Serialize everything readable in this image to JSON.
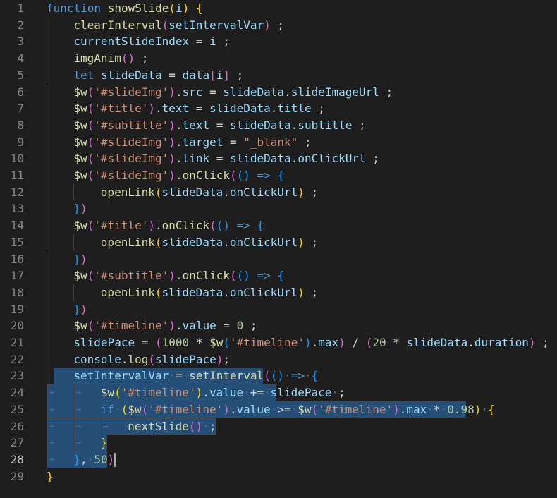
{
  "editor": {
    "active_line": 28,
    "colors": {
      "background": "#1e1e1e",
      "selection": "#264f78",
      "keyword": "#569cd6",
      "function": "#dcdcaa",
      "variable": "#9cdcfe",
      "string": "#ce9178",
      "number": "#b5cea8"
    },
    "lines": [
      {
        "n": 1,
        "indent": 0,
        "tokens": [
          [
            "kw",
            "function"
          ],
          [
            "p",
            " "
          ],
          [
            "fn",
            "showSlide"
          ],
          [
            "b1",
            "("
          ],
          [
            "var",
            "i"
          ],
          [
            "b1",
            ")"
          ],
          [
            "p",
            " "
          ],
          [
            "b1",
            "{"
          ]
        ]
      },
      {
        "n": 2,
        "indent": 1,
        "tokens": [
          [
            "fn",
            "clearInterval"
          ],
          [
            "b2",
            "("
          ],
          [
            "var",
            "setIntervalVar"
          ],
          [
            "b2",
            ")"
          ],
          [
            "p",
            " ;"
          ]
        ]
      },
      {
        "n": 3,
        "indent": 1,
        "tokens": [
          [
            "var",
            "currentSlideIndex"
          ],
          [
            "p",
            " = "
          ],
          [
            "var",
            "i"
          ],
          [
            "p",
            " ;"
          ]
        ]
      },
      {
        "n": 4,
        "indent": 1,
        "tokens": [
          [
            "fn",
            "imgAnim"
          ],
          [
            "b2",
            "()"
          ],
          [
            "p",
            " ;"
          ]
        ]
      },
      {
        "n": 5,
        "indent": 1,
        "tokens": [
          [
            "kw",
            "let"
          ],
          [
            "p",
            " "
          ],
          [
            "var",
            "slideData"
          ],
          [
            "p",
            " = "
          ],
          [
            "var",
            "data"
          ],
          [
            "b2",
            "["
          ],
          [
            "var",
            "i"
          ],
          [
            "b2",
            "]"
          ],
          [
            "p",
            " ;"
          ]
        ]
      },
      {
        "n": 6,
        "indent": 1,
        "tokens": [
          [
            "fn",
            "$w"
          ],
          [
            "b2",
            "("
          ],
          [
            "str",
            "'#slideImg'"
          ],
          [
            "b2",
            ")"
          ],
          [
            "p",
            "."
          ],
          [
            "var",
            "src"
          ],
          [
            "p",
            " = "
          ],
          [
            "var",
            "slideData"
          ],
          [
            "p",
            "."
          ],
          [
            "var",
            "slideImageUrl"
          ],
          [
            "p",
            " ;"
          ]
        ]
      },
      {
        "n": 7,
        "indent": 1,
        "tokens": [
          [
            "fn",
            "$w"
          ],
          [
            "b2",
            "("
          ],
          [
            "str",
            "'#title'"
          ],
          [
            "b2",
            ")"
          ],
          [
            "p",
            "."
          ],
          [
            "var",
            "text"
          ],
          [
            "p",
            " = "
          ],
          [
            "var",
            "slideData"
          ],
          [
            "p",
            "."
          ],
          [
            "var",
            "title"
          ],
          [
            "p",
            " ;"
          ]
        ]
      },
      {
        "n": 8,
        "indent": 1,
        "tokens": [
          [
            "fn",
            "$w"
          ],
          [
            "b2",
            "("
          ],
          [
            "str",
            "'#subtitle'"
          ],
          [
            "b2",
            ")"
          ],
          [
            "p",
            "."
          ],
          [
            "var",
            "text"
          ],
          [
            "p",
            " = "
          ],
          [
            "var",
            "slideData"
          ],
          [
            "p",
            "."
          ],
          [
            "var",
            "subtitle"
          ],
          [
            "p",
            " ;"
          ]
        ]
      },
      {
        "n": 9,
        "indent": 1,
        "tokens": [
          [
            "fn",
            "$w"
          ],
          [
            "b2",
            "("
          ],
          [
            "str",
            "'#slideImg'"
          ],
          [
            "b2",
            ")"
          ],
          [
            "p",
            "."
          ],
          [
            "var",
            "target"
          ],
          [
            "p",
            " = "
          ],
          [
            "str",
            "\"_blank\""
          ],
          [
            "p",
            " ;"
          ]
        ]
      },
      {
        "n": 10,
        "indent": 1,
        "tokens": [
          [
            "fn",
            "$w"
          ],
          [
            "b2",
            "("
          ],
          [
            "str",
            "'#slideImg'"
          ],
          [
            "b2",
            ")"
          ],
          [
            "p",
            "."
          ],
          [
            "var",
            "link"
          ],
          [
            "p",
            " = "
          ],
          [
            "var",
            "slideData"
          ],
          [
            "p",
            "."
          ],
          [
            "var",
            "onClickUrl"
          ],
          [
            "p",
            " ;"
          ]
        ]
      },
      {
        "n": 11,
        "indent": 1,
        "tokens": [
          [
            "fn",
            "$w"
          ],
          [
            "b2",
            "("
          ],
          [
            "str",
            "'#slideImg'"
          ],
          [
            "b2",
            ")"
          ],
          [
            "p",
            "."
          ],
          [
            "fn",
            "onClick"
          ],
          [
            "b2",
            "("
          ],
          [
            "b3",
            "()"
          ],
          [
            "p",
            " "
          ],
          [
            "kw",
            "=>"
          ],
          [
            "p",
            " "
          ],
          [
            "b3",
            "{"
          ]
        ]
      },
      {
        "n": 12,
        "indent": 2,
        "tokens": [
          [
            "fn",
            "openLink"
          ],
          [
            "b1",
            "("
          ],
          [
            "var",
            "slideData"
          ],
          [
            "p",
            "."
          ],
          [
            "var",
            "onClickUrl"
          ],
          [
            "b1",
            ")"
          ],
          [
            "p",
            " ;"
          ]
        ]
      },
      {
        "n": 13,
        "indent": 1,
        "tokens": [
          [
            "b3",
            "}"
          ],
          [
            "b2",
            ")"
          ]
        ]
      },
      {
        "n": 14,
        "indent": 1,
        "tokens": [
          [
            "fn",
            "$w"
          ],
          [
            "b2",
            "("
          ],
          [
            "str",
            "'#title'"
          ],
          [
            "b2",
            ")"
          ],
          [
            "p",
            "."
          ],
          [
            "fn",
            "onClick"
          ],
          [
            "b2",
            "("
          ],
          [
            "b3",
            "()"
          ],
          [
            "p",
            " "
          ],
          [
            "kw",
            "=>"
          ],
          [
            "p",
            " "
          ],
          [
            "b3",
            "{"
          ]
        ]
      },
      {
        "n": 15,
        "indent": 2,
        "tokens": [
          [
            "fn",
            "openLink"
          ],
          [
            "b1",
            "("
          ],
          [
            "var",
            "slideData"
          ],
          [
            "p",
            "."
          ],
          [
            "var",
            "onClickUrl"
          ],
          [
            "b1",
            ")"
          ],
          [
            "p",
            " ;"
          ]
        ]
      },
      {
        "n": 16,
        "indent": 1,
        "tokens": [
          [
            "b3",
            "}"
          ],
          [
            "b2",
            ")"
          ]
        ]
      },
      {
        "n": 17,
        "indent": 1,
        "tokens": [
          [
            "fn",
            "$w"
          ],
          [
            "b2",
            "("
          ],
          [
            "str",
            "'#subtitle'"
          ],
          [
            "b2",
            ")"
          ],
          [
            "p",
            "."
          ],
          [
            "fn",
            "onClick"
          ],
          [
            "b2",
            "("
          ],
          [
            "b3",
            "()"
          ],
          [
            "p",
            " "
          ],
          [
            "kw",
            "=>"
          ],
          [
            "p",
            " "
          ],
          [
            "b3",
            "{"
          ]
        ]
      },
      {
        "n": 18,
        "indent": 2,
        "tokens": [
          [
            "fn",
            "openLink"
          ],
          [
            "b1",
            "("
          ],
          [
            "var",
            "slideData"
          ],
          [
            "p",
            "."
          ],
          [
            "var",
            "onClickUrl"
          ],
          [
            "b1",
            ")"
          ],
          [
            "p",
            " ;"
          ]
        ]
      },
      {
        "n": 19,
        "indent": 1,
        "tokens": [
          [
            "b3",
            "}"
          ],
          [
            "b2",
            ")"
          ]
        ]
      },
      {
        "n": 20,
        "indent": 1,
        "tokens": [
          [
            "fn",
            "$w"
          ],
          [
            "b2",
            "("
          ],
          [
            "str",
            "'#timeline'"
          ],
          [
            "b2",
            ")"
          ],
          [
            "p",
            "."
          ],
          [
            "var",
            "value"
          ],
          [
            "p",
            " = "
          ],
          [
            "num",
            "0"
          ],
          [
            "p",
            " ;"
          ]
        ]
      },
      {
        "n": 21,
        "indent": 1,
        "tokens": [
          [
            "var",
            "slidePace"
          ],
          [
            "p",
            " = "
          ],
          [
            "b2",
            "("
          ],
          [
            "num",
            "1000"
          ],
          [
            "p",
            " * "
          ],
          [
            "fn",
            "$w"
          ],
          [
            "b3",
            "("
          ],
          [
            "str",
            "'#timeline'"
          ],
          [
            "b3",
            ")"
          ],
          [
            "p",
            "."
          ],
          [
            "var",
            "max"
          ],
          [
            "b2",
            ")"
          ],
          [
            "p",
            " / "
          ],
          [
            "b2",
            "("
          ],
          [
            "num",
            "20"
          ],
          [
            "p",
            " * "
          ],
          [
            "var",
            "slideData"
          ],
          [
            "p",
            "."
          ],
          [
            "var",
            "duration"
          ],
          [
            "b2",
            ")"
          ],
          [
            "p",
            " ;"
          ]
        ]
      },
      {
        "n": 22,
        "indent": 1,
        "tokens": [
          [
            "var",
            "console"
          ],
          [
            "p",
            "."
          ],
          [
            "fn",
            "log"
          ],
          [
            "b2",
            "("
          ],
          [
            "var",
            "slidePace"
          ],
          [
            "b2",
            ")"
          ],
          [
            "p",
            ";"
          ]
        ]
      },
      {
        "n": 23,
        "indent": 1,
        "sel": [
          1,
          32
        ],
        "tokens": [
          [
            "var",
            "setIntervalVar"
          ],
          [
            "ws",
            "·"
          ],
          [
            "p",
            "="
          ],
          [
            "ws",
            "·"
          ],
          [
            "fn",
            "setInterval"
          ],
          [
            "b2",
            "("
          ],
          [
            "b3",
            "()"
          ],
          [
            "ws",
            "·"
          ],
          [
            "kw",
            "=>"
          ],
          [
            "ws",
            "·"
          ],
          [
            "b3",
            "{"
          ]
        ]
      },
      {
        "n": 24,
        "indent": 2,
        "sel": [
          0,
          34
        ],
        "tokens": [
          [
            "fn",
            "$w"
          ],
          [
            "b1",
            "("
          ],
          [
            "str",
            "'#timeline'"
          ],
          [
            "b1",
            ")"
          ],
          [
            "p",
            "."
          ],
          [
            "var",
            "value"
          ],
          [
            "ws",
            "·"
          ],
          [
            "p",
            "+="
          ],
          [
            "ws",
            "·"
          ],
          [
            "var",
            "slidePace"
          ],
          [
            "ws",
            "·"
          ],
          [
            "p",
            ";"
          ]
        ]
      },
      {
        "n": 25,
        "indent": 2,
        "sel": [
          0,
          62
        ],
        "tokens": [
          [
            "kw",
            "if"
          ],
          [
            "ws",
            "·"
          ],
          [
            "b1",
            "("
          ],
          [
            "fn",
            "$w"
          ],
          [
            "b2",
            "("
          ],
          [
            "str",
            "'#timeline'"
          ],
          [
            "b2",
            ")"
          ],
          [
            "p",
            "."
          ],
          [
            "var",
            "value"
          ],
          [
            "ws",
            "·"
          ],
          [
            "p",
            ">="
          ],
          [
            "ws",
            "·"
          ],
          [
            "fn",
            "$w"
          ],
          [
            "b2",
            "("
          ],
          [
            "str",
            "'#timeline'"
          ],
          [
            "b2",
            ")"
          ],
          [
            "p",
            "."
          ],
          [
            "var",
            "max"
          ],
          [
            "ws",
            "·"
          ],
          [
            "p",
            "*"
          ],
          [
            "ws",
            "·"
          ],
          [
            "num",
            "0.98"
          ],
          [
            "b1",
            ")"
          ],
          [
            "ws",
            "·"
          ],
          [
            "b1",
            "{"
          ]
        ]
      },
      {
        "n": 26,
        "indent": 3,
        "sel": [
          0,
          25
        ],
        "tokens": [
          [
            "fn",
            "nextSlide"
          ],
          [
            "b2",
            "()"
          ],
          [
            "ws",
            "·"
          ],
          [
            "p",
            ";"
          ]
        ]
      },
      {
        "n": 27,
        "indent": 2,
        "sel": [
          0,
          9
        ],
        "tokens": [
          [
            "b1",
            "}"
          ]
        ]
      },
      {
        "n": 28,
        "indent": 1,
        "sel": [
          0,
          9
        ],
        "tokens": [
          [
            "b3",
            "}"
          ],
          [
            "p",
            ","
          ],
          [
            "ws",
            "·"
          ],
          [
            "num",
            "50"
          ],
          [
            "b2",
            ")"
          ]
        ]
      },
      {
        "n": 29,
        "indent": 0,
        "tokens": [
          [
            "b1",
            "}"
          ]
        ]
      }
    ]
  }
}
